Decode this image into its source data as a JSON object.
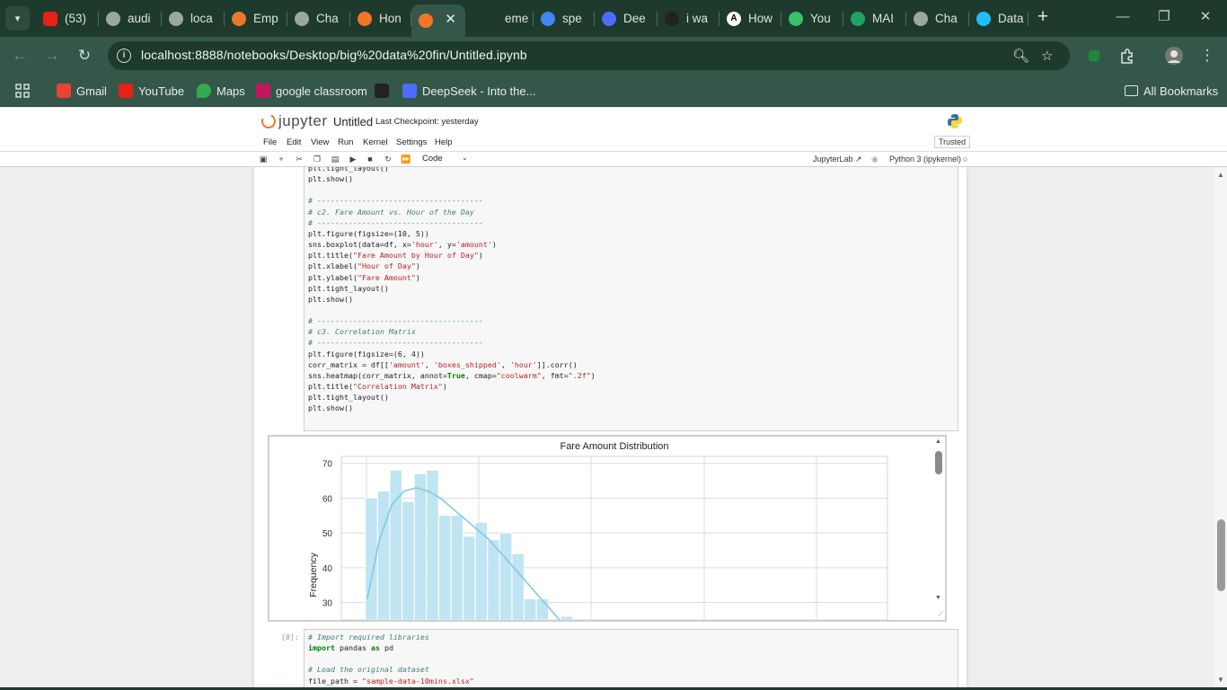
{
  "browser": {
    "tabs": [
      {
        "label": "(53)",
        "icon": "youtube-icon",
        "color": "#e62117"
      },
      {
        "label": "audi",
        "icon": "globe-icon",
        "color": "#9aa8a0"
      },
      {
        "label": "loca",
        "icon": "mountain-icon",
        "color": "#9aa8a0"
      },
      {
        "label": "Emp",
        "icon": "box-icon",
        "color": "#e8792b"
      },
      {
        "label": "Cha",
        "icon": "openai-icon",
        "color": "#9aa8a0"
      },
      {
        "label": "Hon",
        "icon": "jupyter-icon",
        "color": "#f37626"
      },
      {
        "label": "",
        "icon": "notebook-icon",
        "color": "#f37626",
        "active": true
      },
      {
        "label": "eme",
        "icon": "",
        "color": "#9aa8a0"
      },
      {
        "label": "spe",
        "icon": "google-icon",
        "color": "#4285f4"
      },
      {
        "label": "Dee",
        "icon": "deepseek-icon",
        "color": "#4d6bfe"
      },
      {
        "label": "i wa",
        "icon": "perplexity-icon",
        "color": "#222222"
      },
      {
        "label": "How",
        "icon": "anthropic-icon",
        "color": "#ffffff"
      },
      {
        "label": "You",
        "icon": "form-icon",
        "color": "#37c36b"
      },
      {
        "label": "MAI",
        "icon": "sheets-icon",
        "color": "#1ea362"
      },
      {
        "label": "Cha",
        "icon": "openai-icon",
        "color": "#9aa8a0"
      },
      {
        "label": "Data",
        "icon": "k-icon",
        "color": "#20beff"
      }
    ],
    "url": "localhost:8888/notebooks/Desktop/big%20data%20fin/Untitled.ipynb",
    "bookmarks": [
      {
        "label": "Gmail",
        "icon": "gmail-icon",
        "color": "#ea4335"
      },
      {
        "label": "YouTube",
        "icon": "youtube-icon",
        "color": "#e62117"
      },
      {
        "label": "Maps",
        "icon": "maps-icon",
        "color": "#34a853"
      },
      {
        "label": "google classroom",
        "icon": "classroom-icon",
        "color": "#c2185b"
      },
      {
        "label": "",
        "icon": "perplexity-icon",
        "color": "#222222"
      },
      {
        "label": "DeepSeek - Into the...",
        "icon": "deepseek-icon",
        "color": "#4d6bfe"
      }
    ],
    "all_bookmarks": "All Bookmarks"
  },
  "jupyter": {
    "logo": "jupyter",
    "notebook_name": "Untitled",
    "checkpoint": "Last Checkpoint: yesterday",
    "menu": [
      "File",
      "Edit",
      "View",
      "Run",
      "Kernel",
      "Settings",
      "Help"
    ],
    "trusted": "Trusted",
    "cell_type": "Code",
    "jupyterlab_link": "JupyterLab",
    "kernel": "Python 3 (ipykernel)"
  },
  "cell1": {
    "lines": [
      "plt.tight_layout()",
      "plt.show()",
      "",
      "# -------------------------------------",
      "# c2. Fare Amount vs. Hour of the Day",
      "# -------------------------------------",
      "plt.figure(figsize=(10, 5))",
      "sns.boxplot(data=df, x='hour', y='amount')",
      "plt.title(\"Fare Amount by Hour of Day\")",
      "plt.xlabel(\"Hour of Day\")",
      "plt.ylabel(\"Fare Amount\")",
      "plt.tight_layout()",
      "plt.show()",
      "",
      "# -------------------------------------",
      "# c3. Correlation Matrix",
      "# -------------------------------------",
      "plt.figure(figsize=(6, 4))",
      "corr_matrix = df[['amount', 'boxes_shipped', 'hour']].corr()",
      "sns.heatmap(corr_matrix, annot=True, cmap=\"coolwarm\", fmt=\".2f\")",
      "plt.title(\"Correlation Matrix\")",
      "plt.tight_layout()",
      "plt.show()"
    ]
  },
  "cell2": {
    "prompt": "[8]:",
    "lines": [
      "# Import required libraries",
      "import pandas as pd",
      "",
      "# Load the original dataset",
      "file_path = \"sample-data-10mins.xlsx\""
    ]
  },
  "chart_data": {
    "type": "bar",
    "title": "Fare Amount Distribution",
    "xlabel": "",
    "ylabel": "Frequency",
    "ylim": [
      25,
      72
    ],
    "yticks": [
      30,
      40,
      50,
      60,
      70
    ],
    "grid": true,
    "bar_color": "#bfe4f2",
    "kde_color": "#7ecbe6",
    "values": [
      60,
      62,
      68,
      59,
      67,
      68,
      55,
      55,
      49,
      53,
      48,
      50,
      44,
      31,
      31,
      25,
      26
    ],
    "kde": [
      31,
      48,
      58,
      62,
      63,
      62,
      60,
      57,
      54,
      51,
      48,
      44,
      40,
      36,
      32,
      28,
      24
    ]
  }
}
